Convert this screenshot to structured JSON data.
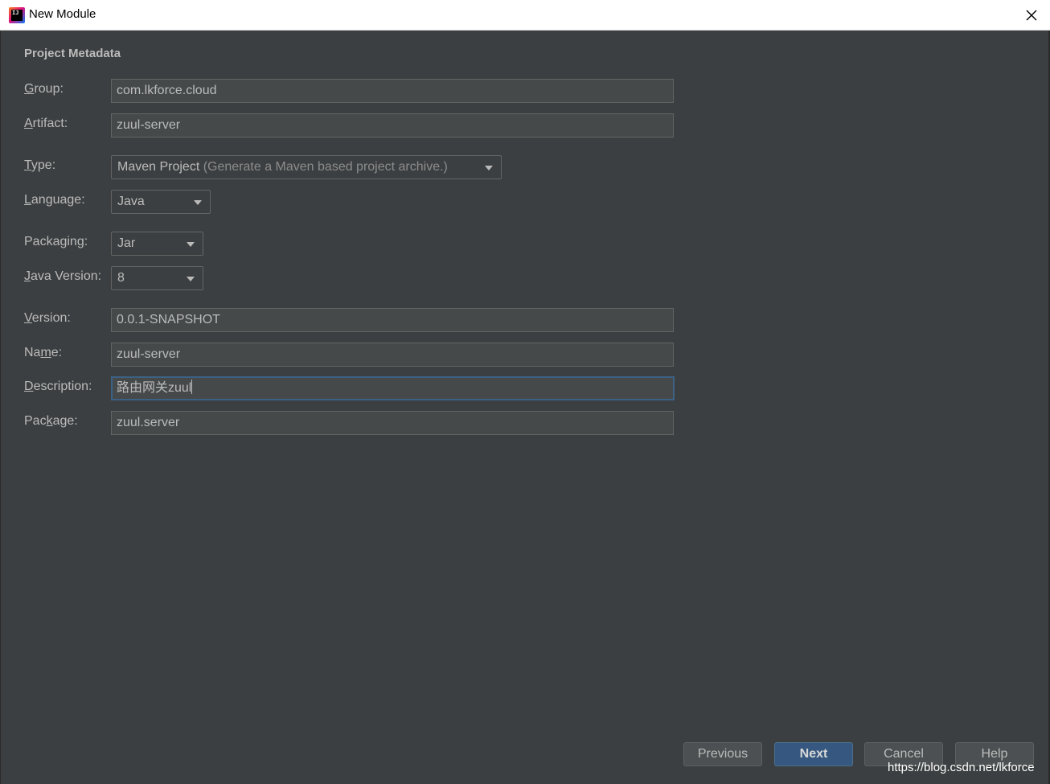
{
  "window": {
    "title": "New Module",
    "app_icon": "intellij-idea-icon",
    "app_icon_text": "IJ",
    "close_icon": "close-icon"
  },
  "section": {
    "title": "Project Metadata"
  },
  "fields": {
    "group": {
      "label_mn": "G",
      "label_rest": "roup:",
      "value": "com.lkforce.cloud"
    },
    "artifact": {
      "label_mn": "A",
      "label_rest": "rtifact:",
      "value": "zuul-server"
    },
    "type": {
      "label_mn": "T",
      "label_rest": "ype:",
      "value": "Maven Project",
      "hint": "(Generate a Maven based project archive.)"
    },
    "language": {
      "label_mn": "L",
      "label_rest": "anguage:",
      "value": "Java"
    },
    "packaging": {
      "label_pre": "Packa",
      "label_mn": "g",
      "label_rest": "ing:",
      "value": "Jar"
    },
    "java_version": {
      "label_mn": "J",
      "label_rest": "ava Version:",
      "value": "8"
    },
    "version": {
      "label_mn": "V",
      "label_rest": "ersion:",
      "value": "0.0.1-SNAPSHOT"
    },
    "name": {
      "label_pre": "Na",
      "label_mn": "m",
      "label_rest": "e:",
      "value": "zuul-server"
    },
    "description": {
      "label_mn": "D",
      "label_rest": "escription:",
      "value": "路由网关zuul"
    },
    "package": {
      "label_pre": "Pac",
      "label_mn": "k",
      "label_rest": "age:",
      "value": "zuul.server"
    }
  },
  "buttons": {
    "previous": "Previous",
    "next": "Next",
    "cancel": "Cancel",
    "help": "Help"
  },
  "watermark": "https://blog.csdn.net/lkforce",
  "colors": {
    "background": "#3c3f41",
    "field_bg": "#45494a",
    "text": "#bbbbbb",
    "primary_button": "#365880",
    "focus_border": "#3d6185"
  }
}
